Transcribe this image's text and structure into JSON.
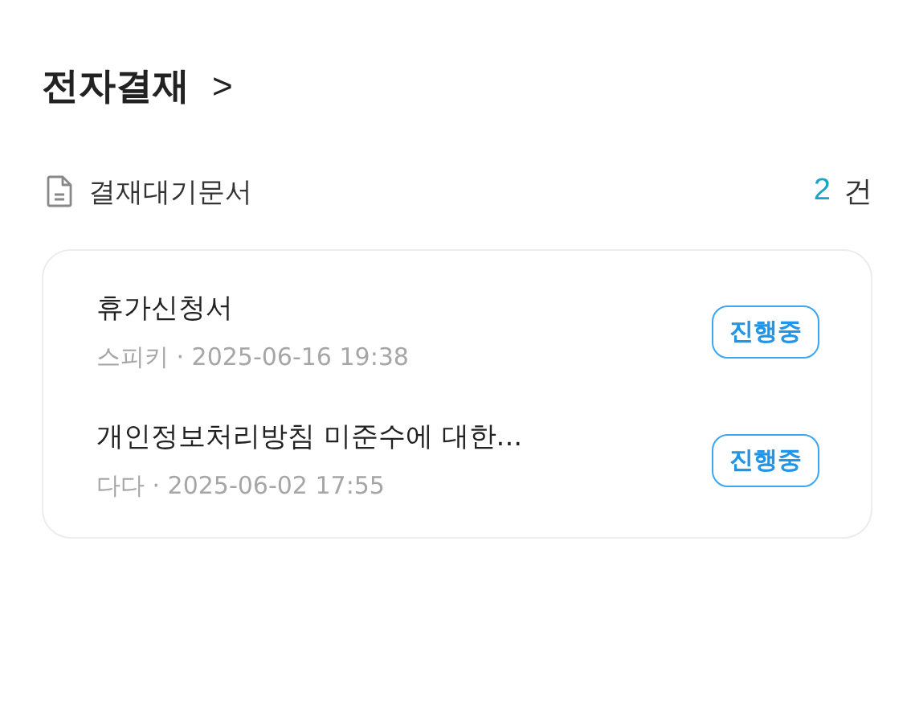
{
  "header": {
    "title": "전자결재",
    "chevron": ">"
  },
  "section": {
    "label": "결재대기문서",
    "count": "2",
    "unit": "건"
  },
  "documents": [
    {
      "title": "휴가신청서",
      "meta": "스피키 · 2025-06-16 19:38",
      "status": "진행중"
    },
    {
      "title": "개인정보처리방침 미준수에 대한...",
      "meta": "다다 · 2025-06-02 17:55",
      "status": "진행중"
    }
  ]
}
